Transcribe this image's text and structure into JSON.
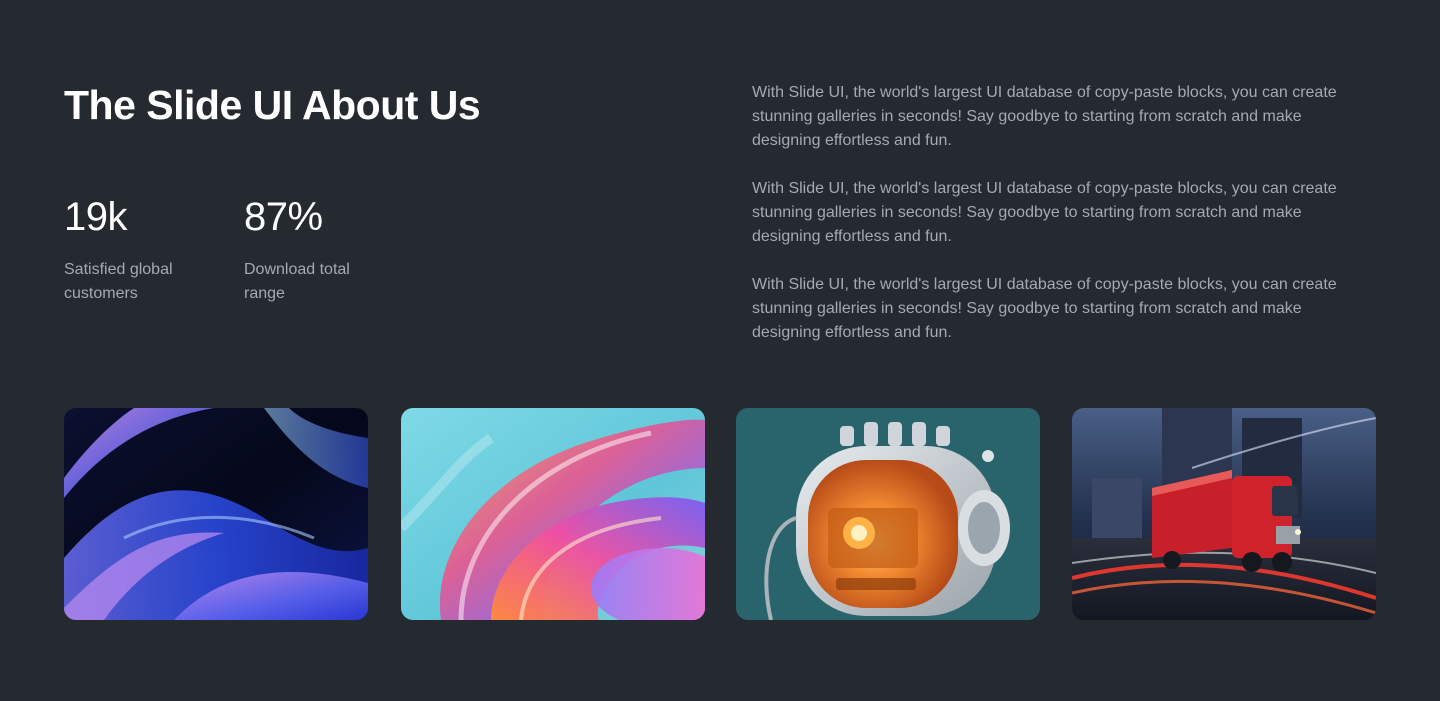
{
  "header": {
    "title": "The Slide UI About Us"
  },
  "stats": [
    {
      "value": "19k",
      "label": "Satisfied global customers"
    },
    {
      "value": "87%",
      "label": "Download total range"
    }
  ],
  "description": {
    "paragraphs": [
      "With Slide UI, the world's largest UI database of copy-paste blocks, you can create stunning galleries in seconds! Say goodbye to starting from scratch and make designing effortless and fun.",
      "With Slide UI, the world's largest UI database of copy-paste blocks, you can create stunning galleries in seconds! Say goodbye to starting from scratch and make designing effortless and fun.",
      "With Slide UI, the world's largest UI database of copy-paste blocks, you can create stunning galleries in seconds! Say goodbye to starting from scratch and make designing effortless and fun."
    ]
  },
  "gallery": {
    "images": [
      {
        "icon": "abstract-blue-waves-image"
      },
      {
        "icon": "abstract-glass-swirl-image"
      },
      {
        "icon": "orange-robot-device-image"
      },
      {
        "icon": "red-truck-night-image"
      }
    ]
  },
  "colors": {
    "background": "#242a2f",
    "heading": "#ffffff",
    "body_text": "#a4aab1"
  }
}
